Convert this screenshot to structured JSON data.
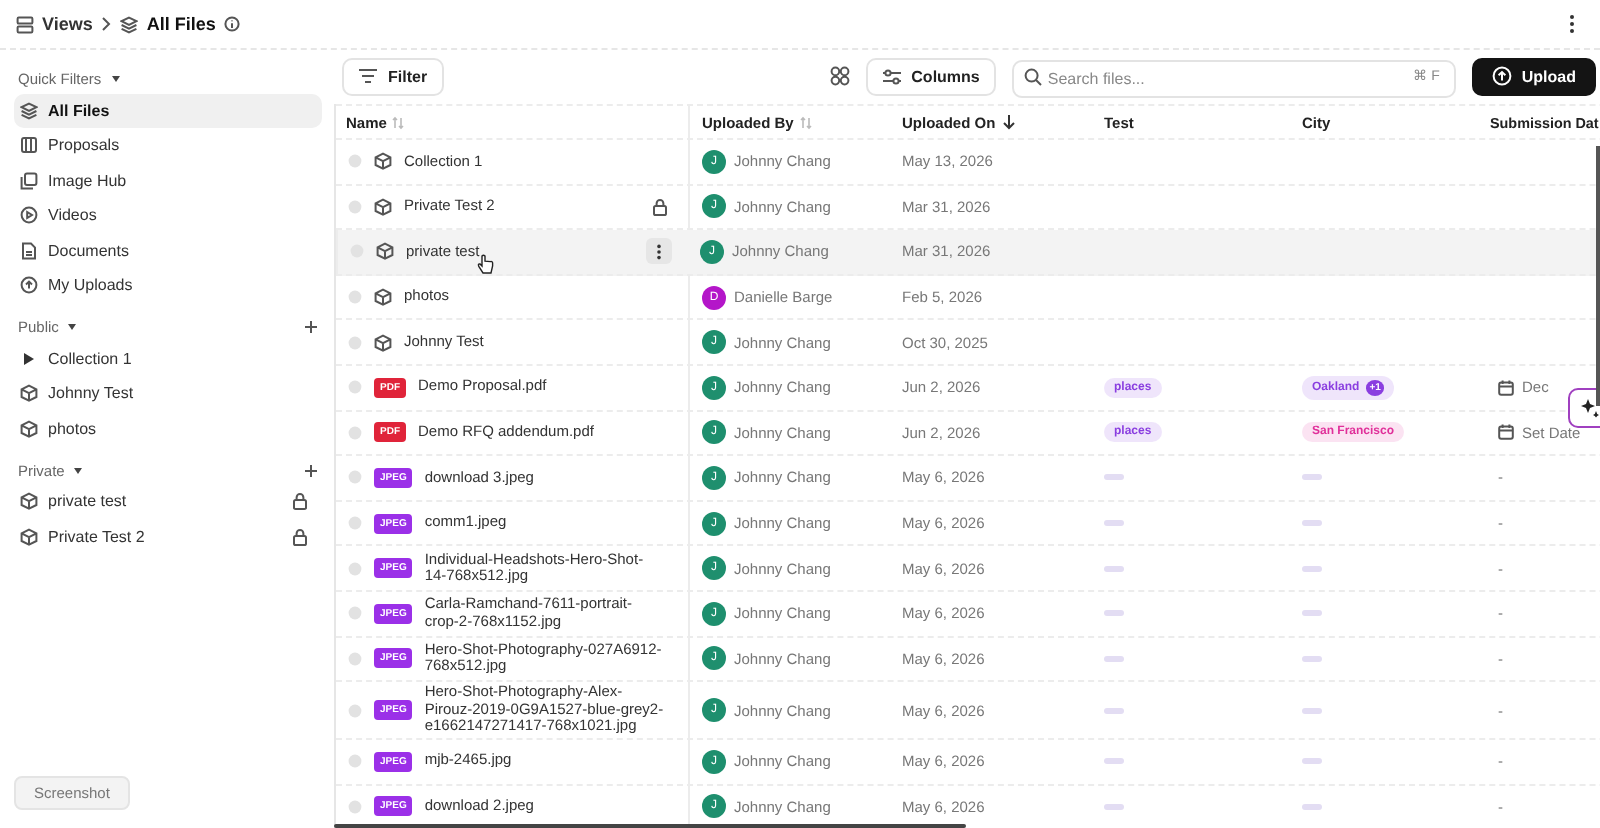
{
  "breadcrumb": {
    "parent": "Views",
    "current": "All Files"
  },
  "sidebar": {
    "sections": [
      {
        "title": "Quick Filters",
        "kind": "filters",
        "items": [
          {
            "label": "All Files",
            "selected": true
          },
          {
            "label": "Proposals",
            "selected": false
          },
          {
            "label": "Image Hub",
            "selected": false
          },
          {
            "label": "Videos",
            "selected": false
          },
          {
            "label": "Documents",
            "selected": false
          },
          {
            "label": "My Uploads",
            "selected": false
          }
        ]
      },
      {
        "title": "Public",
        "kind": "collections",
        "items": [
          {
            "label": "Collection 1",
            "selected": false,
            "expanded": false,
            "locked": false
          },
          {
            "label": "Johnny Test",
            "selected": false,
            "locked": false
          },
          {
            "label": "photos",
            "selected": false,
            "locked": false
          }
        ]
      },
      {
        "title": "Private",
        "kind": "collections",
        "items": [
          {
            "label": "private test",
            "selected": false,
            "locked": true
          },
          {
            "label": "Private Test 2",
            "selected": false,
            "locked": true
          }
        ]
      }
    ]
  },
  "toolbar": {
    "filter": "Filter",
    "columns": "Columns",
    "search_placeholder": "Search files...",
    "shortcut": "⌘ F",
    "upload": "Upload"
  },
  "table": {
    "columns": [
      {
        "label": "Name",
        "sortable": true,
        "sorted": false
      },
      {
        "label": "Uploaded By",
        "sortable": true,
        "sorted": false
      },
      {
        "label": "Uploaded On",
        "sortable": true,
        "sorted": true
      },
      {
        "label": "Test",
        "sortable": false
      },
      {
        "label": "City",
        "sortable": false
      },
      {
        "label": "Submission Dat",
        "sortable": false
      }
    ],
    "rows": [
      {
        "kind": "collection",
        "name": "Collection 1",
        "locked": false,
        "hovered": false,
        "uploader": {
          "initial": "J",
          "name": "Johnny Chang",
          "color": "#1e8f6e"
        },
        "date": "May 13, 2026"
      },
      {
        "kind": "collection",
        "name": "Private Test 2",
        "locked": true,
        "hovered": false,
        "uploader": {
          "initial": "J",
          "name": "Johnny Chang",
          "color": "#1e8f6e"
        },
        "date": "Mar 31, 2026"
      },
      {
        "kind": "collection",
        "name": "private test",
        "locked": false,
        "hovered": true,
        "uploader": {
          "initial": "J",
          "name": "Johnny Chang",
          "color": "#1e8f6e"
        },
        "date": "Mar 31, 2026"
      },
      {
        "kind": "collection",
        "name": "photos",
        "locked": false,
        "hovered": false,
        "uploader": {
          "initial": "D",
          "name": "Danielle Barge",
          "color": "#b416c9"
        },
        "date": "Feb 5, 2026"
      },
      {
        "kind": "collection",
        "name": "Johnny Test",
        "locked": false,
        "hovered": false,
        "uploader": {
          "initial": "J",
          "name": "Johnny Chang",
          "color": "#1e8f6e"
        },
        "date": "Oct 30, 2025"
      },
      {
        "kind": "file",
        "badge": "PDF",
        "color": "#e0243a",
        "name": "Demo Proposal.pdf",
        "locked": false,
        "hovered": false,
        "uploader": {
          "initial": "J",
          "name": "Johnny Chang",
          "color": "#1e8f6e"
        },
        "date": "Jun 2, 2026",
        "test": {
          "kind": "tag",
          "label": "places",
          "color": "#8a3ee0"
        },
        "city": {
          "kind": "tag",
          "label": "Oakland",
          "extra": "+1",
          "color": "#8a3ee0"
        },
        "submission": {
          "kind": "date",
          "label": "Dec"
        }
      },
      {
        "kind": "file",
        "badge": "PDF",
        "color": "#e0243a",
        "name": "Demo RFQ addendum.pdf",
        "locked": false,
        "hovered": false,
        "uploader": {
          "initial": "J",
          "name": "Johnny Chang",
          "color": "#1e8f6e"
        },
        "date": "Jun 2, 2026",
        "test": {
          "kind": "tag",
          "label": "places",
          "color": "#8a3ee0"
        },
        "city": {
          "kind": "tag",
          "label": "San Francisco",
          "color": "#e0309a"
        },
        "submission": {
          "kind": "date",
          "label": "Set Date"
        }
      },
      {
        "kind": "file",
        "badge": "JPEG",
        "color": "#9b30e8",
        "name": "download 3.jpeg",
        "locked": false,
        "hovered": false,
        "uploader": {
          "initial": "J",
          "name": "Johnny Chang",
          "color": "#1e8f6e"
        },
        "date": "May 6, 2026",
        "test": {
          "kind": "empty"
        },
        "city": {
          "kind": "empty"
        },
        "submission": {
          "kind": "none",
          "label": "-"
        }
      },
      {
        "kind": "file",
        "badge": "JPEG",
        "color": "#9b30e8",
        "name": "comm1.jpeg",
        "locked": false,
        "hovered": false,
        "uploader": {
          "initial": "J",
          "name": "Johnny Chang",
          "color": "#1e8f6e"
        },
        "date": "May 6, 2026",
        "test": {
          "kind": "empty"
        },
        "city": {
          "kind": "empty"
        },
        "submission": {
          "kind": "none",
          "label": "-"
        }
      },
      {
        "kind": "file",
        "badge": "JPEG",
        "color": "#9b30e8",
        "name": "Individual-Headshots-Hero-Shot-14-768x512.jpg",
        "locked": false,
        "hovered": false,
        "uploader": {
          "initial": "J",
          "name": "Johnny Chang",
          "color": "#1e8f6e"
        },
        "date": "May 6, 2026",
        "test": {
          "kind": "empty"
        },
        "city": {
          "kind": "empty"
        },
        "submission": {
          "kind": "none",
          "label": "-"
        }
      },
      {
        "kind": "file",
        "badge": "JPEG",
        "color": "#9b30e8",
        "name": "Carla-Ramchand-7611-portrait-crop-2-768x1152.jpg",
        "locked": false,
        "hovered": false,
        "uploader": {
          "initial": "J",
          "name": "Johnny Chang",
          "color": "#1e8f6e"
        },
        "date": "May 6, 2026",
        "test": {
          "kind": "empty"
        },
        "city": {
          "kind": "empty"
        },
        "submission": {
          "kind": "none",
          "label": "-"
        }
      },
      {
        "kind": "file",
        "badge": "JPEG",
        "color": "#9b30e8",
        "name": "Hero-Shot-Photography-027A6912-768x512.jpg",
        "locked": false,
        "hovered": false,
        "uploader": {
          "initial": "J",
          "name": "Johnny Chang",
          "color": "#1e8f6e"
        },
        "date": "May 6, 2026",
        "test": {
          "kind": "empty"
        },
        "city": {
          "kind": "empty"
        },
        "submission": {
          "kind": "none",
          "label": "-"
        }
      },
      {
        "kind": "file",
        "badge": "JPEG",
        "color": "#9b30e8",
        "name": "Hero-Shot-Photography-Alex-Pirouz-2019-0G9A1527-blue-grey2-e1662147271417-768x1021.jpg",
        "locked": false,
        "hovered": false,
        "uploader": {
          "initial": "J",
          "name": "Johnny Chang",
          "color": "#1e8f6e"
        },
        "date": "May 6, 2026",
        "test": {
          "kind": "empty"
        },
        "city": {
          "kind": "empty"
        },
        "submission": {
          "kind": "none",
          "label": "-"
        }
      },
      {
        "kind": "file",
        "badge": "JPEG",
        "color": "#9b30e8",
        "name": "mjb-2465.jpg",
        "locked": false,
        "hovered": false,
        "uploader": {
          "initial": "J",
          "name": "Johnny Chang",
          "color": "#1e8f6e"
        },
        "date": "May 6, 2026",
        "test": {
          "kind": "empty"
        },
        "city": {
          "kind": "empty"
        },
        "submission": {
          "kind": "none",
          "label": "-"
        }
      },
      {
        "kind": "file",
        "badge": "JPEG",
        "color": "#9b30e8",
        "name": "download 2.jpeg",
        "locked": false,
        "hovered": false,
        "uploader": {
          "initial": "J",
          "name": "Johnny Chang",
          "color": "#1e8f6e"
        },
        "date": "May 6, 2026",
        "test": {
          "kind": "empty"
        },
        "city": {
          "kind": "empty"
        },
        "submission": {
          "kind": "none",
          "label": "-"
        }
      }
    ]
  },
  "tooltip": "Screenshot"
}
